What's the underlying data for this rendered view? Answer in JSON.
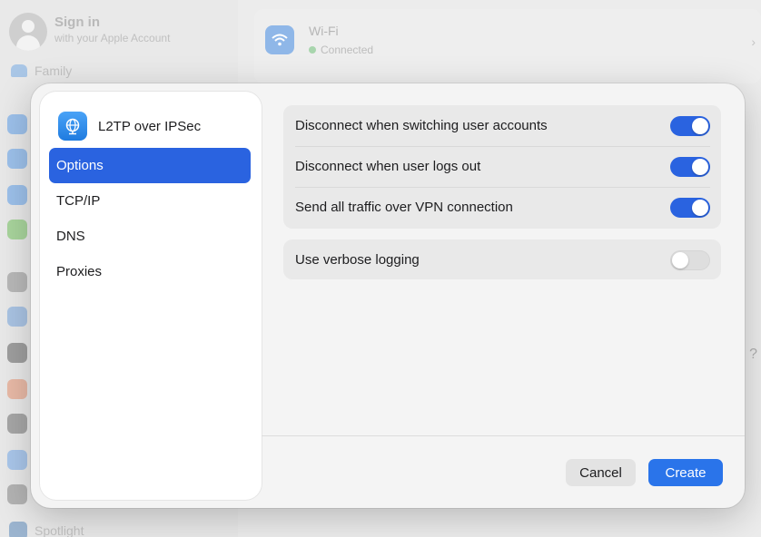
{
  "background": {
    "signin_title": "Sign in",
    "signin_subtitle": "with your Apple Account",
    "family_label": "Family",
    "wifi_title": "Wi-Fi",
    "wifi_status": "Connected",
    "spotlight_label": "Spotlight",
    "help_glyph": "?",
    "chevron_glyph": "›"
  },
  "dialog": {
    "title": "L2TP over IPSec",
    "icon": "vpn-globe-icon",
    "nav": [
      {
        "label": "Options",
        "selected": true
      },
      {
        "label": "TCP/IP",
        "selected": false
      },
      {
        "label": "DNS",
        "selected": false
      },
      {
        "label": "Proxies",
        "selected": false
      }
    ],
    "options_group1": [
      {
        "label": "Disconnect when switching user accounts",
        "enabled": true
      },
      {
        "label": "Disconnect when user logs out",
        "enabled": true
      },
      {
        "label": "Send all traffic over VPN connection",
        "enabled": true
      }
    ],
    "options_group2": [
      {
        "label": "Use verbose logging",
        "enabled": false
      }
    ],
    "cancel_label": "Cancel",
    "create_label": "Create"
  },
  "colors": {
    "accent": "#2a63e0",
    "create_button": "#2a74ea",
    "toggle_off": "#dedede"
  }
}
